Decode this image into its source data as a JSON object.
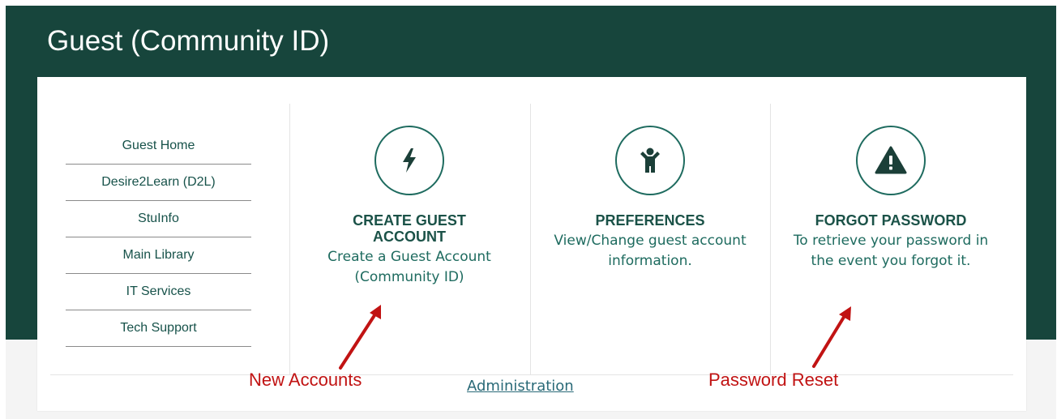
{
  "header": {
    "title": "Guest (Community ID)"
  },
  "sidebar": {
    "items": [
      {
        "label": "Guest Home"
      },
      {
        "label": "Desire2Learn (D2L)"
      },
      {
        "label": "StuInfo"
      },
      {
        "label": "Main Library"
      },
      {
        "label": "IT Services"
      },
      {
        "label": "Tech Support"
      }
    ]
  },
  "tiles": [
    {
      "icon": "lightning-bolt-icon",
      "title": "CREATE GUEST ACCOUNT",
      "description": "Create a Guest Account (Community ID)"
    },
    {
      "icon": "person-icon",
      "title": "PREFERENCES",
      "description": "View/Change guest account information."
    },
    {
      "icon": "warning-triangle-icon",
      "title": "FORGOT PASSWORD",
      "description": "To retrieve your password in the event you forgot it."
    }
  ],
  "footer": {
    "admin_link": "Administration"
  },
  "annotations": {
    "new_accounts": "New Accounts",
    "password_reset": "Password Reset"
  },
  "colors": {
    "brand_dark_green": "#17453c",
    "accent_teal": "#1e6b5f",
    "annotation_red": "#c11313"
  }
}
